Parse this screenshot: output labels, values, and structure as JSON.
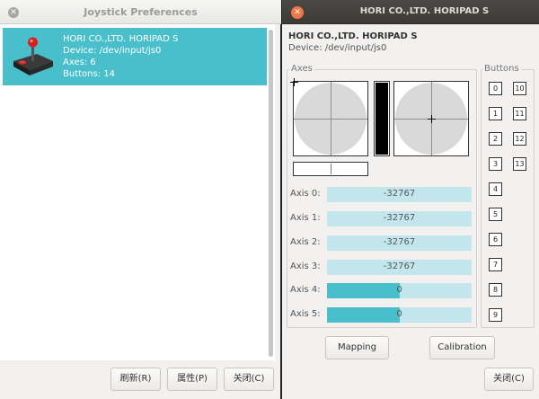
{
  "left_window": {
    "title": "Joystick Preferences",
    "device": {
      "name": "HORI CO.,LTD. HORIPAD S",
      "device_line": "Device: /dev/input/js0",
      "axes_line": "Axes: 6",
      "buttons_line": "Buttons: 14"
    },
    "buttons": {
      "refresh": "刷新(R)",
      "properties": "属性(P)",
      "close": "关闭(C)"
    }
  },
  "right_window": {
    "title": "HORI CO.,LTD. HORIPAD S",
    "device_name": "HORI CO.,LTD. HORIPAD S",
    "device_path": "Device: /dev/input/js0",
    "axes_label": "Axes",
    "buttons_label": "Buttons",
    "axes": [
      {
        "label": "Axis 0:",
        "value": "-32767",
        "fill": 0
      },
      {
        "label": "Axis 1:",
        "value": "-32767",
        "fill": 0
      },
      {
        "label": "Axis 2:",
        "value": "-32767",
        "fill": 0
      },
      {
        "label": "Axis 3:",
        "value": "-32767",
        "fill": 0
      },
      {
        "label": "Axis 4:",
        "value": "0",
        "fill": 0.5
      },
      {
        "label": "Axis 5:",
        "value": "0",
        "fill": 0.5
      }
    ],
    "button_numbers": [
      "0",
      "1",
      "2",
      "3",
      "4",
      "5",
      "6",
      "7",
      "8",
      "9",
      "10",
      "11",
      "12",
      "13"
    ],
    "mapping_button": "Mapping",
    "calibration_button": "Calibration",
    "close_button": "关闭(C)"
  },
  "colors": {
    "accent": "#4abfcc",
    "track": "#c2e6eb",
    "close_active": "#f07746"
  },
  "icons": {
    "left_close": "close-icon",
    "right_close": "close-icon",
    "joystick": "joystick-icon"
  }
}
